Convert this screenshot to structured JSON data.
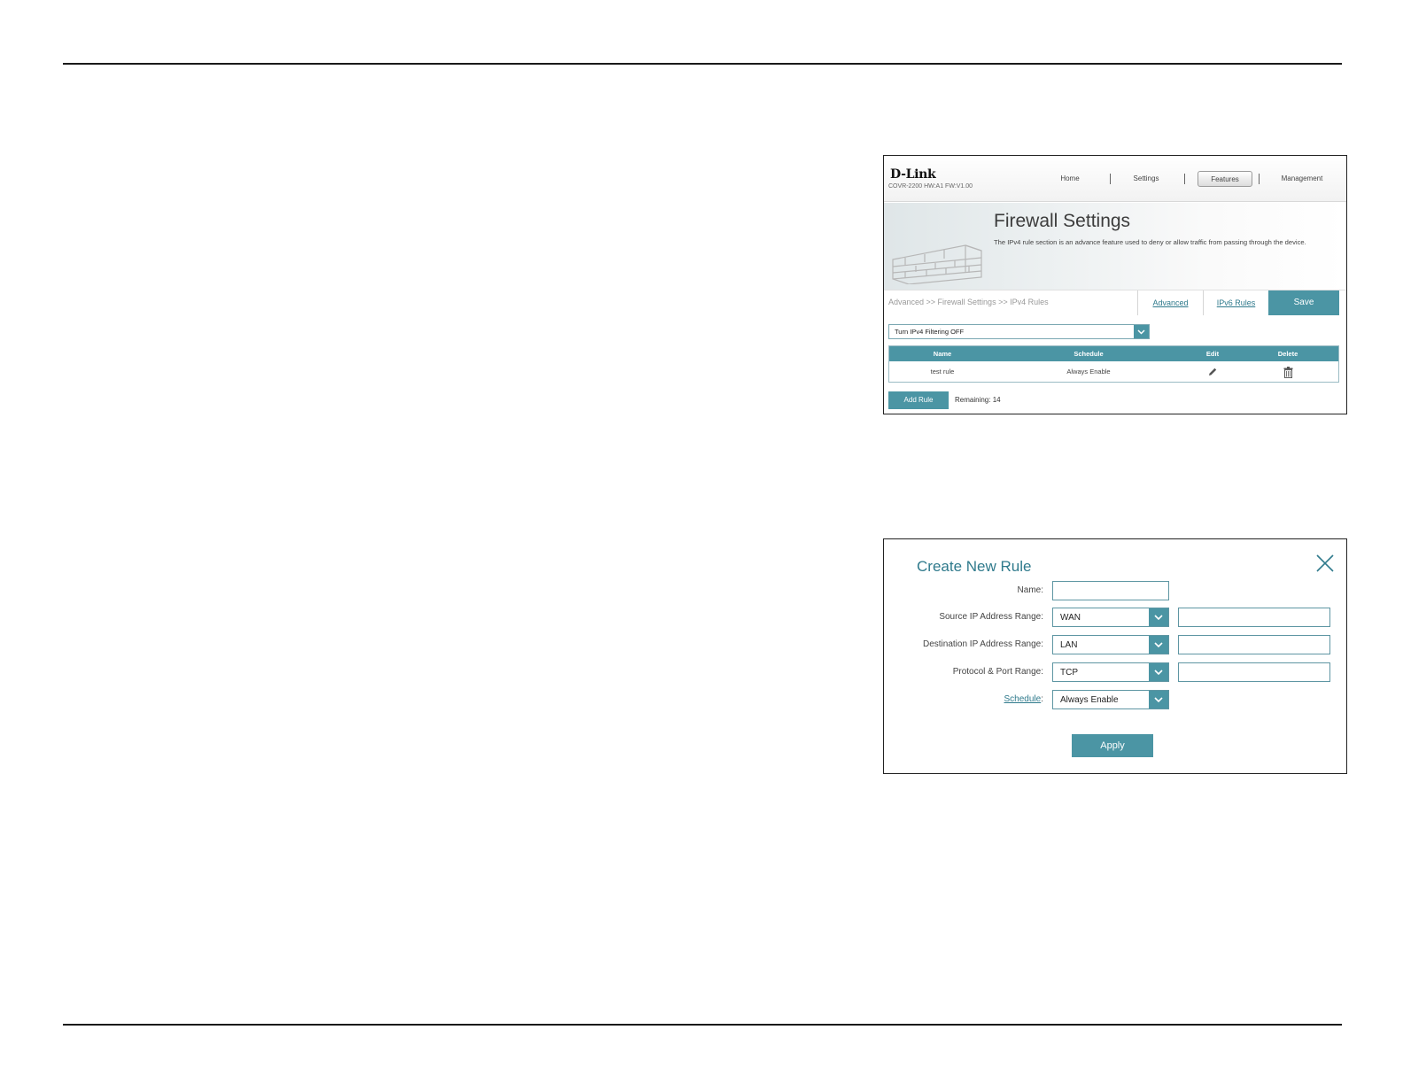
{
  "firewall": {
    "logo": "D-Link",
    "model": "COVR-2200 HW:A1 FW:V1.00",
    "nav": {
      "home": "Home",
      "settings": "Settings",
      "features": "Features",
      "management": "Management"
    },
    "title": "Firewall Settings",
    "description": "The IPv4 rule section is an advance feature used to deny or allow traffic from passing through the device.",
    "breadcrumb": "Advanced >> Firewall Settings >> IPv4 Rules",
    "advanced_link": "Advanced",
    "ipv6_link": "IPv6 Rules",
    "save_label": "Save",
    "filter_select": "Turn IPv4 Filtering OFF",
    "table": {
      "headers": [
        "Name",
        "Schedule",
        "Edit",
        "Delete"
      ],
      "rows": [
        {
          "name": "test rule",
          "schedule": "Always Enable"
        }
      ]
    },
    "add_rule_label": "Add Rule",
    "remaining": "Remaining: 14",
    "icons": {
      "edit": "pencil-icon",
      "delete": "trash-icon",
      "dropdown": "chevron-down-icon"
    }
  },
  "create_rule": {
    "title": "Create New Rule",
    "fields": {
      "name_label": "Name:",
      "name_value": "",
      "source_label": "Source IP Address Range:",
      "source_select": "WAN",
      "source_value": "",
      "dest_label": "Destination IP Address Range:",
      "dest_select": "LAN",
      "dest_value": "",
      "protocol_label": "Protocol & Port Range:",
      "protocol_select": "TCP",
      "protocol_value": "",
      "schedule_label": "Schedule",
      "schedule_colon": ":",
      "schedule_select": "Always Enable"
    },
    "apply_label": "Apply",
    "icons": {
      "close": "close-icon"
    }
  },
  "colors": {
    "accent": "#4b95a4",
    "link": "#2f7a8c"
  }
}
